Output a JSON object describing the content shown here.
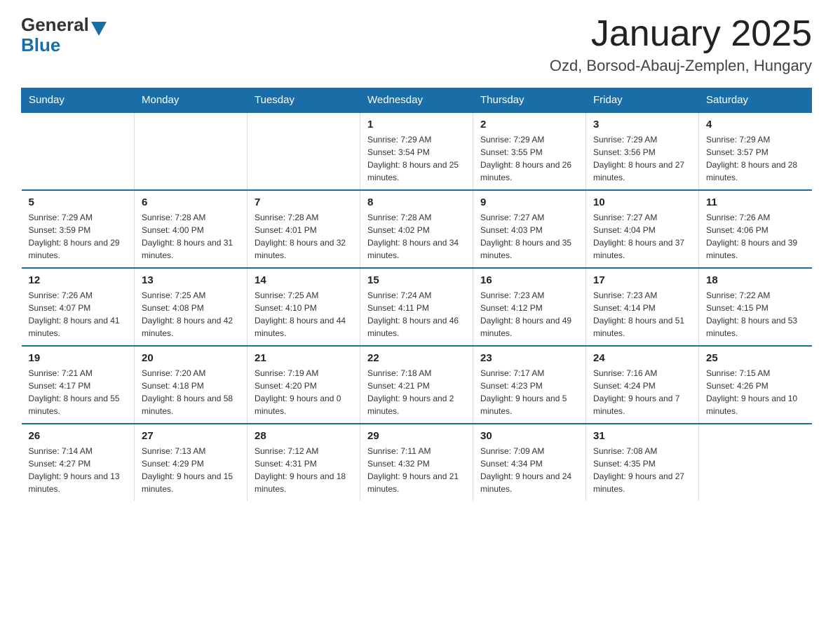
{
  "logo": {
    "general": "General",
    "blue": "Blue",
    "arrow": "▶"
  },
  "header": {
    "title": "January 2025",
    "subtitle": "Ozd, Borsod-Abauj-Zemplen, Hungary"
  },
  "weekdays": [
    "Sunday",
    "Monday",
    "Tuesday",
    "Wednesday",
    "Thursday",
    "Friday",
    "Saturday"
  ],
  "weeks": [
    [
      {
        "day": "",
        "sunrise": "",
        "sunset": "",
        "daylight": ""
      },
      {
        "day": "",
        "sunrise": "",
        "sunset": "",
        "daylight": ""
      },
      {
        "day": "",
        "sunrise": "",
        "sunset": "",
        "daylight": ""
      },
      {
        "day": "1",
        "sunrise": "Sunrise: 7:29 AM",
        "sunset": "Sunset: 3:54 PM",
        "daylight": "Daylight: 8 hours and 25 minutes."
      },
      {
        "day": "2",
        "sunrise": "Sunrise: 7:29 AM",
        "sunset": "Sunset: 3:55 PM",
        "daylight": "Daylight: 8 hours and 26 minutes."
      },
      {
        "day": "3",
        "sunrise": "Sunrise: 7:29 AM",
        "sunset": "Sunset: 3:56 PM",
        "daylight": "Daylight: 8 hours and 27 minutes."
      },
      {
        "day": "4",
        "sunrise": "Sunrise: 7:29 AM",
        "sunset": "Sunset: 3:57 PM",
        "daylight": "Daylight: 8 hours and 28 minutes."
      }
    ],
    [
      {
        "day": "5",
        "sunrise": "Sunrise: 7:29 AM",
        "sunset": "Sunset: 3:59 PM",
        "daylight": "Daylight: 8 hours and 29 minutes."
      },
      {
        "day": "6",
        "sunrise": "Sunrise: 7:28 AM",
        "sunset": "Sunset: 4:00 PM",
        "daylight": "Daylight: 8 hours and 31 minutes."
      },
      {
        "day": "7",
        "sunrise": "Sunrise: 7:28 AM",
        "sunset": "Sunset: 4:01 PM",
        "daylight": "Daylight: 8 hours and 32 minutes."
      },
      {
        "day": "8",
        "sunrise": "Sunrise: 7:28 AM",
        "sunset": "Sunset: 4:02 PM",
        "daylight": "Daylight: 8 hours and 34 minutes."
      },
      {
        "day": "9",
        "sunrise": "Sunrise: 7:27 AM",
        "sunset": "Sunset: 4:03 PM",
        "daylight": "Daylight: 8 hours and 35 minutes."
      },
      {
        "day": "10",
        "sunrise": "Sunrise: 7:27 AM",
        "sunset": "Sunset: 4:04 PM",
        "daylight": "Daylight: 8 hours and 37 minutes."
      },
      {
        "day": "11",
        "sunrise": "Sunrise: 7:26 AM",
        "sunset": "Sunset: 4:06 PM",
        "daylight": "Daylight: 8 hours and 39 minutes."
      }
    ],
    [
      {
        "day": "12",
        "sunrise": "Sunrise: 7:26 AM",
        "sunset": "Sunset: 4:07 PM",
        "daylight": "Daylight: 8 hours and 41 minutes."
      },
      {
        "day": "13",
        "sunrise": "Sunrise: 7:25 AM",
        "sunset": "Sunset: 4:08 PM",
        "daylight": "Daylight: 8 hours and 42 minutes."
      },
      {
        "day": "14",
        "sunrise": "Sunrise: 7:25 AM",
        "sunset": "Sunset: 4:10 PM",
        "daylight": "Daylight: 8 hours and 44 minutes."
      },
      {
        "day": "15",
        "sunrise": "Sunrise: 7:24 AM",
        "sunset": "Sunset: 4:11 PM",
        "daylight": "Daylight: 8 hours and 46 minutes."
      },
      {
        "day": "16",
        "sunrise": "Sunrise: 7:23 AM",
        "sunset": "Sunset: 4:12 PM",
        "daylight": "Daylight: 8 hours and 49 minutes."
      },
      {
        "day": "17",
        "sunrise": "Sunrise: 7:23 AM",
        "sunset": "Sunset: 4:14 PM",
        "daylight": "Daylight: 8 hours and 51 minutes."
      },
      {
        "day": "18",
        "sunrise": "Sunrise: 7:22 AM",
        "sunset": "Sunset: 4:15 PM",
        "daylight": "Daylight: 8 hours and 53 minutes."
      }
    ],
    [
      {
        "day": "19",
        "sunrise": "Sunrise: 7:21 AM",
        "sunset": "Sunset: 4:17 PM",
        "daylight": "Daylight: 8 hours and 55 minutes."
      },
      {
        "day": "20",
        "sunrise": "Sunrise: 7:20 AM",
        "sunset": "Sunset: 4:18 PM",
        "daylight": "Daylight: 8 hours and 58 minutes."
      },
      {
        "day": "21",
        "sunrise": "Sunrise: 7:19 AM",
        "sunset": "Sunset: 4:20 PM",
        "daylight": "Daylight: 9 hours and 0 minutes."
      },
      {
        "day": "22",
        "sunrise": "Sunrise: 7:18 AM",
        "sunset": "Sunset: 4:21 PM",
        "daylight": "Daylight: 9 hours and 2 minutes."
      },
      {
        "day": "23",
        "sunrise": "Sunrise: 7:17 AM",
        "sunset": "Sunset: 4:23 PM",
        "daylight": "Daylight: 9 hours and 5 minutes."
      },
      {
        "day": "24",
        "sunrise": "Sunrise: 7:16 AM",
        "sunset": "Sunset: 4:24 PM",
        "daylight": "Daylight: 9 hours and 7 minutes."
      },
      {
        "day": "25",
        "sunrise": "Sunrise: 7:15 AM",
        "sunset": "Sunset: 4:26 PM",
        "daylight": "Daylight: 9 hours and 10 minutes."
      }
    ],
    [
      {
        "day": "26",
        "sunrise": "Sunrise: 7:14 AM",
        "sunset": "Sunset: 4:27 PM",
        "daylight": "Daylight: 9 hours and 13 minutes."
      },
      {
        "day": "27",
        "sunrise": "Sunrise: 7:13 AM",
        "sunset": "Sunset: 4:29 PM",
        "daylight": "Daylight: 9 hours and 15 minutes."
      },
      {
        "day": "28",
        "sunrise": "Sunrise: 7:12 AM",
        "sunset": "Sunset: 4:31 PM",
        "daylight": "Daylight: 9 hours and 18 minutes."
      },
      {
        "day": "29",
        "sunrise": "Sunrise: 7:11 AM",
        "sunset": "Sunset: 4:32 PM",
        "daylight": "Daylight: 9 hours and 21 minutes."
      },
      {
        "day": "30",
        "sunrise": "Sunrise: 7:09 AM",
        "sunset": "Sunset: 4:34 PM",
        "daylight": "Daylight: 9 hours and 24 minutes."
      },
      {
        "day": "31",
        "sunrise": "Sunrise: 7:08 AM",
        "sunset": "Sunset: 4:35 PM",
        "daylight": "Daylight: 9 hours and 27 minutes."
      },
      {
        "day": "",
        "sunrise": "",
        "sunset": "",
        "daylight": ""
      }
    ]
  ]
}
